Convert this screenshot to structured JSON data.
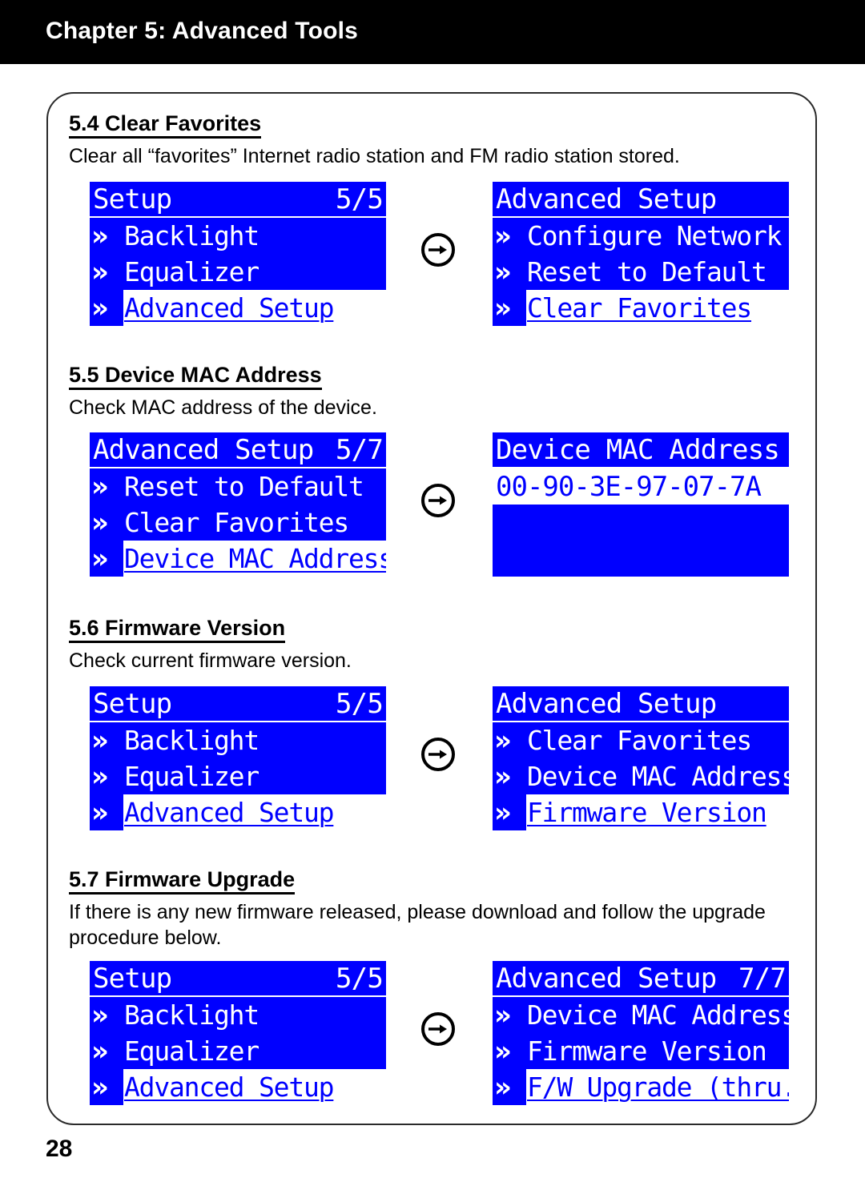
{
  "header": {
    "title": "Chapter 5: Advanced Tools"
  },
  "page": {
    "number": "28"
  },
  "icons": {
    "transition_arrow": "circle-arrow-right-icon",
    "menu_chevron": "double-chevron-right-icon"
  },
  "colors": {
    "lcd_background": "#0000FF",
    "lcd_text": "#FFFFFF",
    "lcd_selected_background": "#FFFFFF",
    "lcd_selected_text": "#0000FF",
    "header_background": "#000000",
    "header_text": "#FFFFFF"
  },
  "sections": [
    {
      "heading": "5.4 Clear Favorites",
      "description": "Clear all “favorites” Internet radio station and FM radio station stored.",
      "screens": {
        "left": {
          "title": "Setup",
          "page_indicator": "5/5",
          "items": [
            {
              "label": "Backlight",
              "selected": false
            },
            {
              "label": "Equalizer",
              "selected": false
            },
            {
              "label": "Advanced Setup",
              "selected": true
            }
          ]
        },
        "right": {
          "title": "Advanced Setup",
          "page_indicator": "",
          "items": [
            {
              "label": "Configure Network",
              "selected": false
            },
            {
              "label": "Reset to Default",
              "selected": false
            },
            {
              "label": "Clear Favorites",
              "selected": true
            }
          ]
        }
      }
    },
    {
      "heading": "5.5 Device MAC Address",
      "description": "Check MAC address of the device.",
      "screens": {
        "left": {
          "title": "Advanced Setup",
          "page_indicator": "5/7",
          "items": [
            {
              "label": "Reset to Default",
              "selected": false
            },
            {
              "label": "Clear Favorites",
              "selected": false
            },
            {
              "label": "Device MAC Address",
              "selected": true
            }
          ]
        },
        "right": {
          "title": "Device MAC Address",
          "page_indicator": "",
          "value": "00-90-3E-97-07-7A",
          "items": []
        }
      }
    },
    {
      "heading": "5.6 Firmware Version",
      "description": "Check current firmware version.",
      "screens": {
        "left": {
          "title": "Setup",
          "page_indicator": "5/5",
          "items": [
            {
              "label": "Backlight",
              "selected": false
            },
            {
              "label": "Equalizer",
              "selected": false
            },
            {
              "label": "Advanced Setup",
              "selected": true
            }
          ]
        },
        "right": {
          "title": "Advanced Setup",
          "page_indicator": "",
          "items": [
            {
              "label": "Clear Favorites",
              "selected": false
            },
            {
              "label": "Device MAC Address",
              "selected": false
            },
            {
              "label": "Firmware Version",
              "selected": true
            }
          ]
        }
      }
    },
    {
      "heading": "5.7 Firmware Upgrade",
      "description": "If there is any new firmware released, please download and follow the upgrade procedure below.",
      "screens": {
        "left": {
          "title": "Setup",
          "page_indicator": "5/5",
          "items": [
            {
              "label": "Backlight",
              "selected": false
            },
            {
              "label": "Equalizer",
              "selected": false
            },
            {
              "label": "Advanced Setup",
              "selected": true
            }
          ]
        },
        "right": {
          "title": "Advanced Setup",
          "page_indicator": "7/7",
          "items": [
            {
              "label": "Device MAC Address",
              "selected": false
            },
            {
              "label": "Firmware Version",
              "selected": false
            },
            {
              "label": "F/W Upgrade (thru. U",
              "selected": true
            }
          ]
        }
      }
    }
  ]
}
